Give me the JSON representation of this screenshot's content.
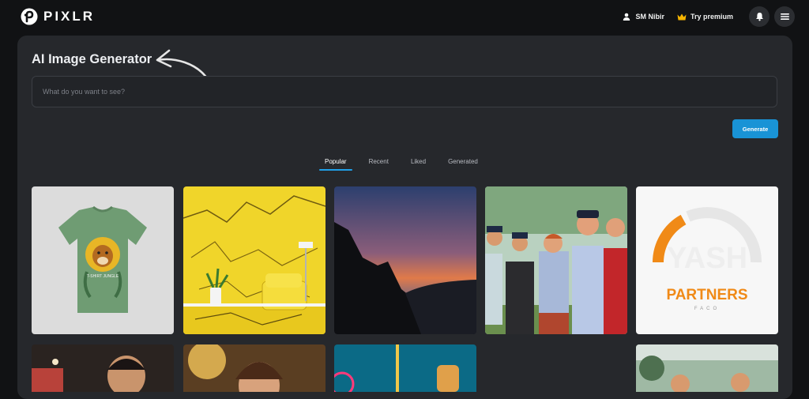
{
  "app": {
    "name": "PIXLR"
  },
  "header": {
    "user_name": "SM Nibir",
    "premium_label": "Try premium",
    "icons": [
      "pixlr-logo-icon",
      "user-icon",
      "crown-icon",
      "bell-icon",
      "menu-icon"
    ]
  },
  "generator": {
    "title": "AI Image Generator",
    "prompt_placeholder": "What do you want to see?",
    "prompt_value": "",
    "generate_label": "Generate"
  },
  "tabs": [
    {
      "label": "Popular",
      "active": true
    },
    {
      "label": "Recent",
      "active": false
    },
    {
      "label": "Liked",
      "active": false
    },
    {
      "label": "Generated",
      "active": false
    }
  ],
  "gallery": {
    "row1": [
      {
        "name": "tshirt-jungle",
        "caption": "T-SHIRT JUNGLE"
      },
      {
        "name": "yellow-marble-room"
      },
      {
        "name": "mountain-sunset"
      },
      {
        "name": "golfers-group"
      },
      {
        "name": "yash-partners-logo",
        "text_main": "YASH",
        "text_sub": "PARTNERS",
        "text_small": "FACO"
      }
    ],
    "row2_count": 5
  },
  "colors": {
    "background": "#111214",
    "panel": "#26282c",
    "accent": "#1993d6",
    "premium_crown": "#f5b400",
    "logo_orange": "#f08a17"
  }
}
